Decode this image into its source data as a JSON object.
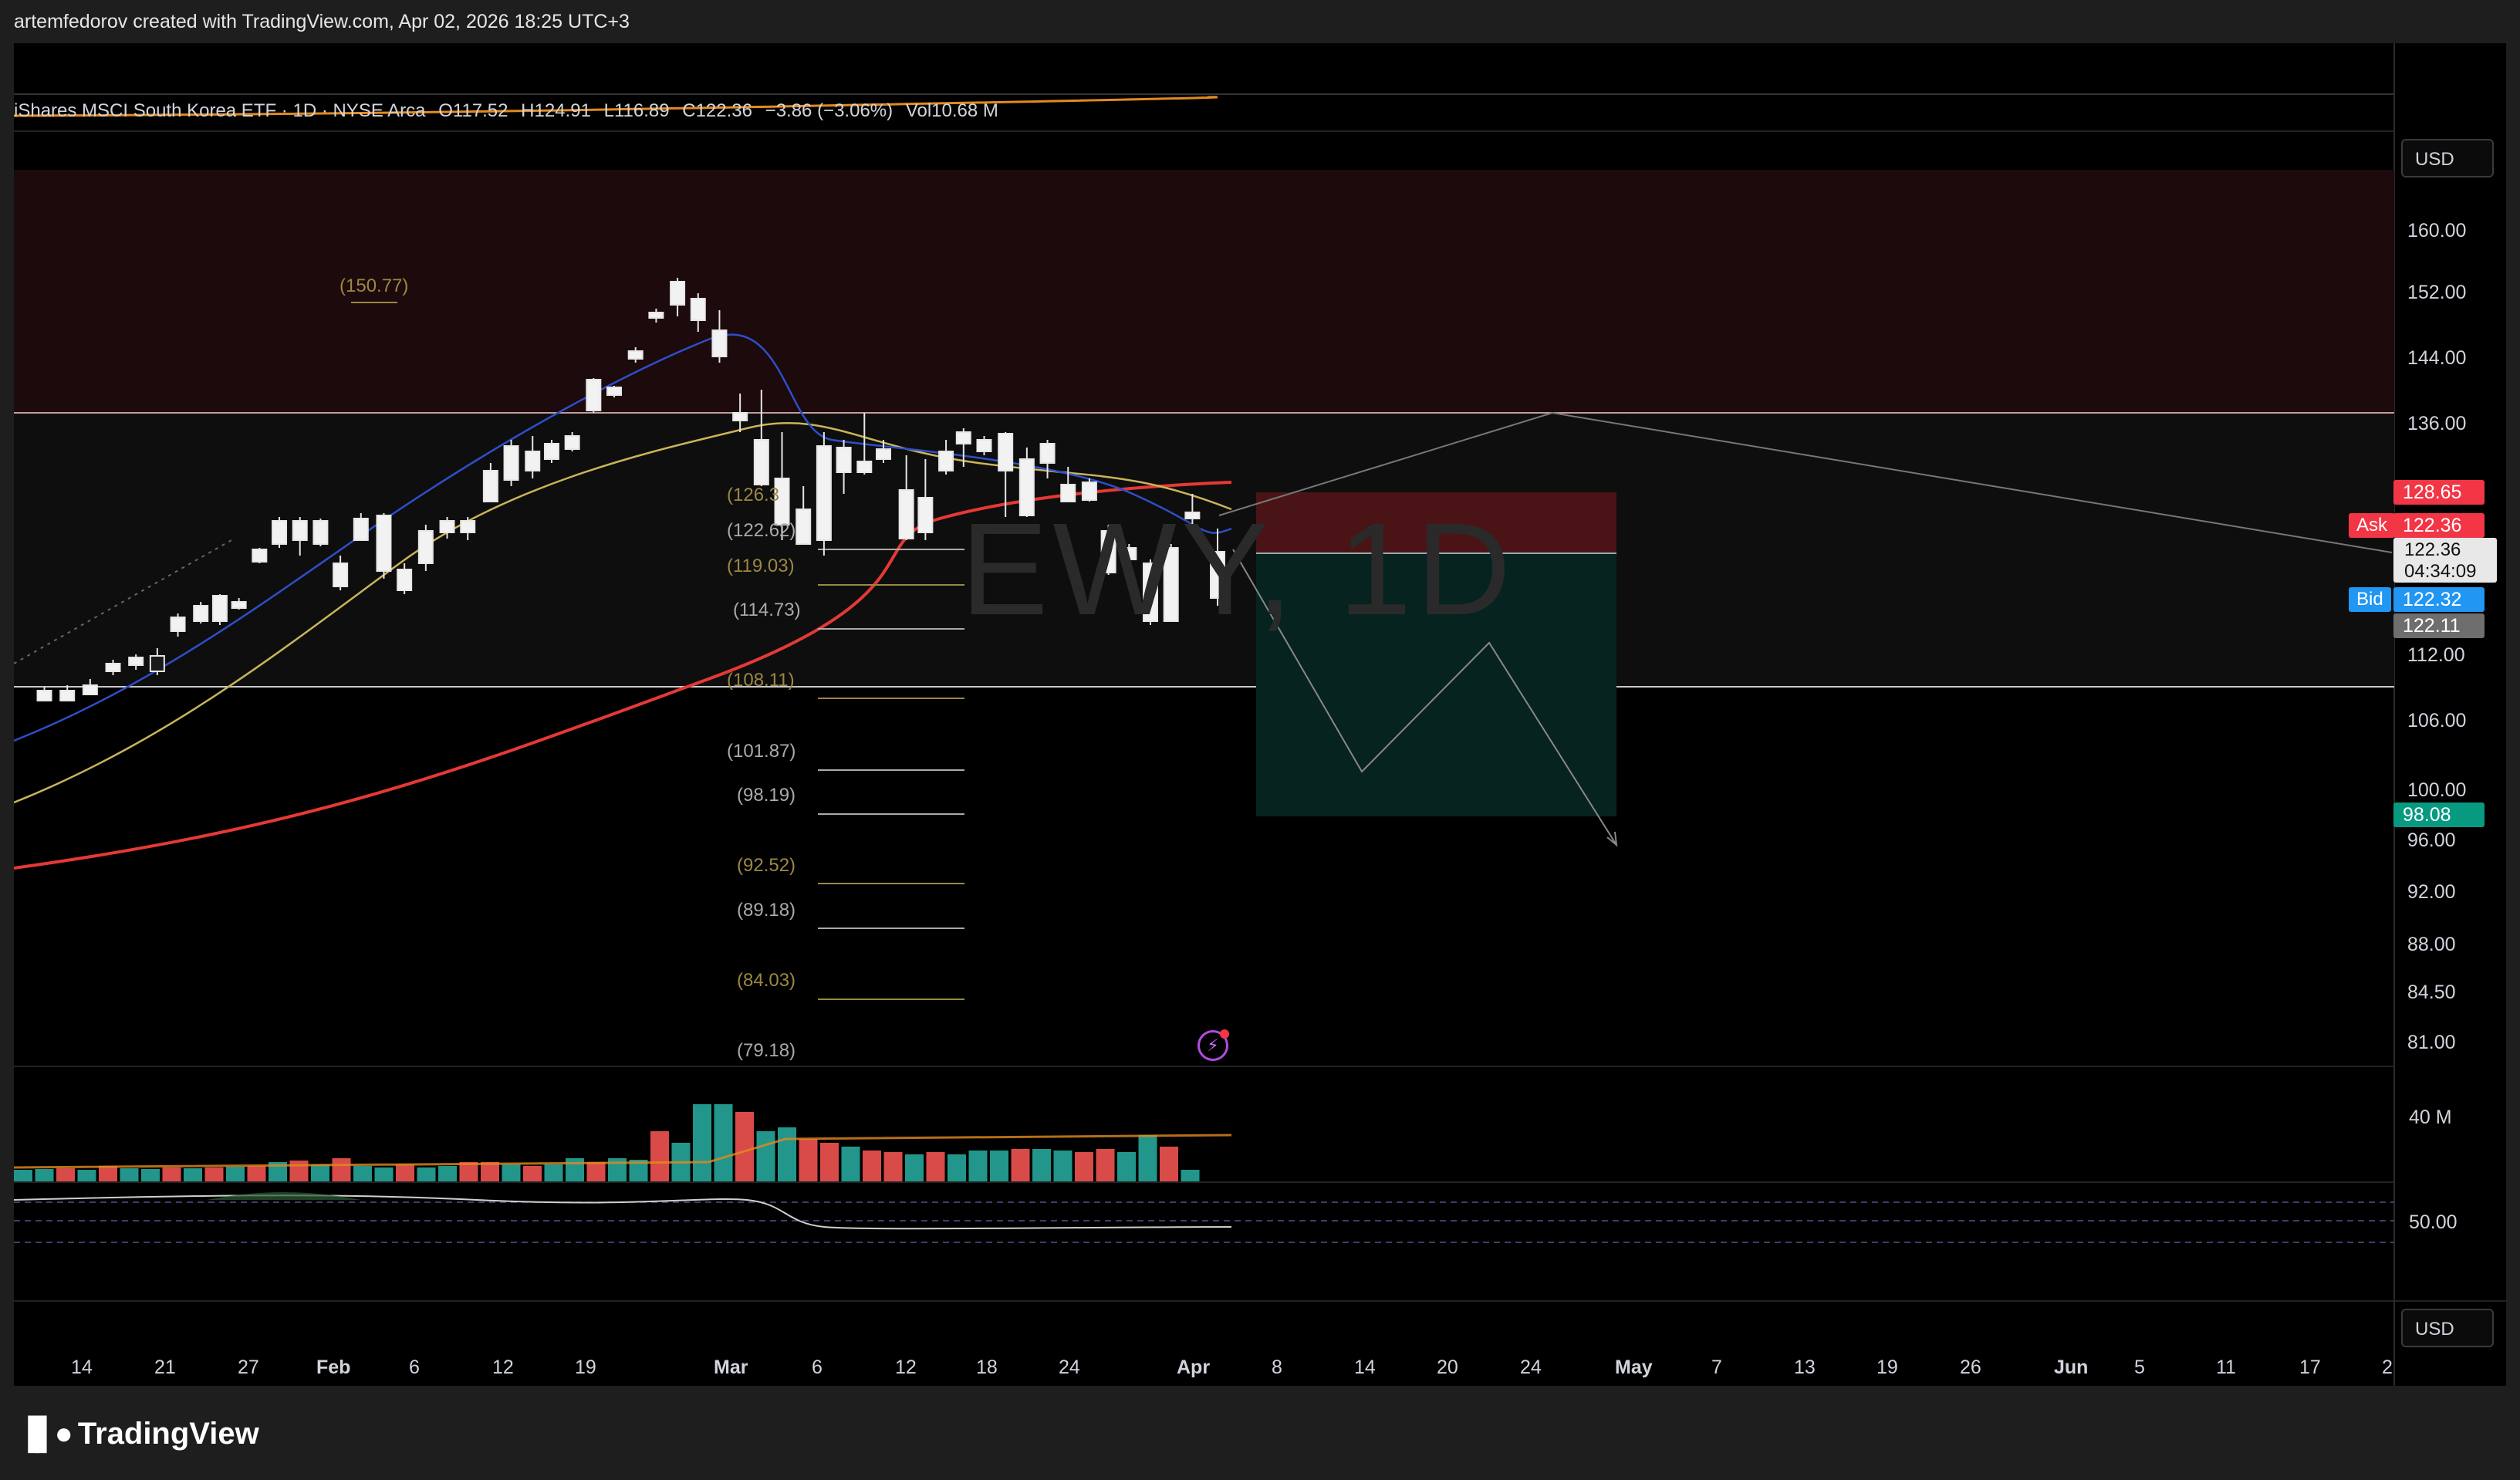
{
  "caption": "artemfedorov created with TradingView.com, Apr 02, 2026 18:25 UTC+3",
  "legend": {
    "symbol": "iShares MSCI South Korea ETF · 1D · NYSE Arca",
    "open": "O117.52",
    "high": "H124.91",
    "low": "L116.89",
    "close": "C122.36",
    "change": "−3.86 (−3.06%)",
    "volume": "Vol10.68 M"
  },
  "watermark": "EWY, 1D",
  "currency_top": "USD",
  "currency_bottom": "USD",
  "price_axis": [
    "160.00",
    "152.00",
    "144.00",
    "136.00",
    "112.00",
    "106.00",
    "100.00",
    "96.00",
    "92.00",
    "88.00",
    "84.50",
    "81.00"
  ],
  "volume_axis": "40 M",
  "rsi_axis": "50.00",
  "price_tags": {
    "ma_red": "128.65",
    "ask_label": "Ask",
    "ask": "122.36",
    "last": "122.36",
    "countdown": "04:34:09",
    "bid_label": "Bid",
    "bid": "122.32",
    "gray": "122.11",
    "target": "98.08"
  },
  "fib_levels": [
    "(150.77)",
    "(126.3",
    "(122.62)",
    "(119.03)",
    "(114.73)",
    "(108.11)",
    "(101.87)",
    "(98.19)",
    "(92.52)",
    "(89.18)",
    "(84.03)",
    "(79.18)"
  ],
  "time_axis": [
    "14",
    "21",
    "27",
    "Feb",
    "6",
    "12",
    "19",
    "Mar",
    "6",
    "12",
    "18",
    "24",
    "Apr",
    "8",
    "14",
    "20",
    "24",
    "May",
    "7",
    "13",
    "19",
    "26",
    "Jun",
    "5",
    "11",
    "17",
    "2"
  ],
  "colors": {
    "background": "#000000",
    "resistance_zone": "#1c0a0c",
    "ma_red": "#e53935",
    "ma_blue": "#2e4ec9",
    "ma_yellow": "#c9b458",
    "ask_red": "#f23645",
    "bid_blue": "#2196f3",
    "target_green": "#089981",
    "volume_up": "#26a69a",
    "volume_down": "#ef5350",
    "fib_gold": "#9c8744"
  },
  "brand": "TradingView",
  "icons": {
    "alert": "lightning-alert-icon",
    "logo": "tradingview-logo-icon"
  }
}
